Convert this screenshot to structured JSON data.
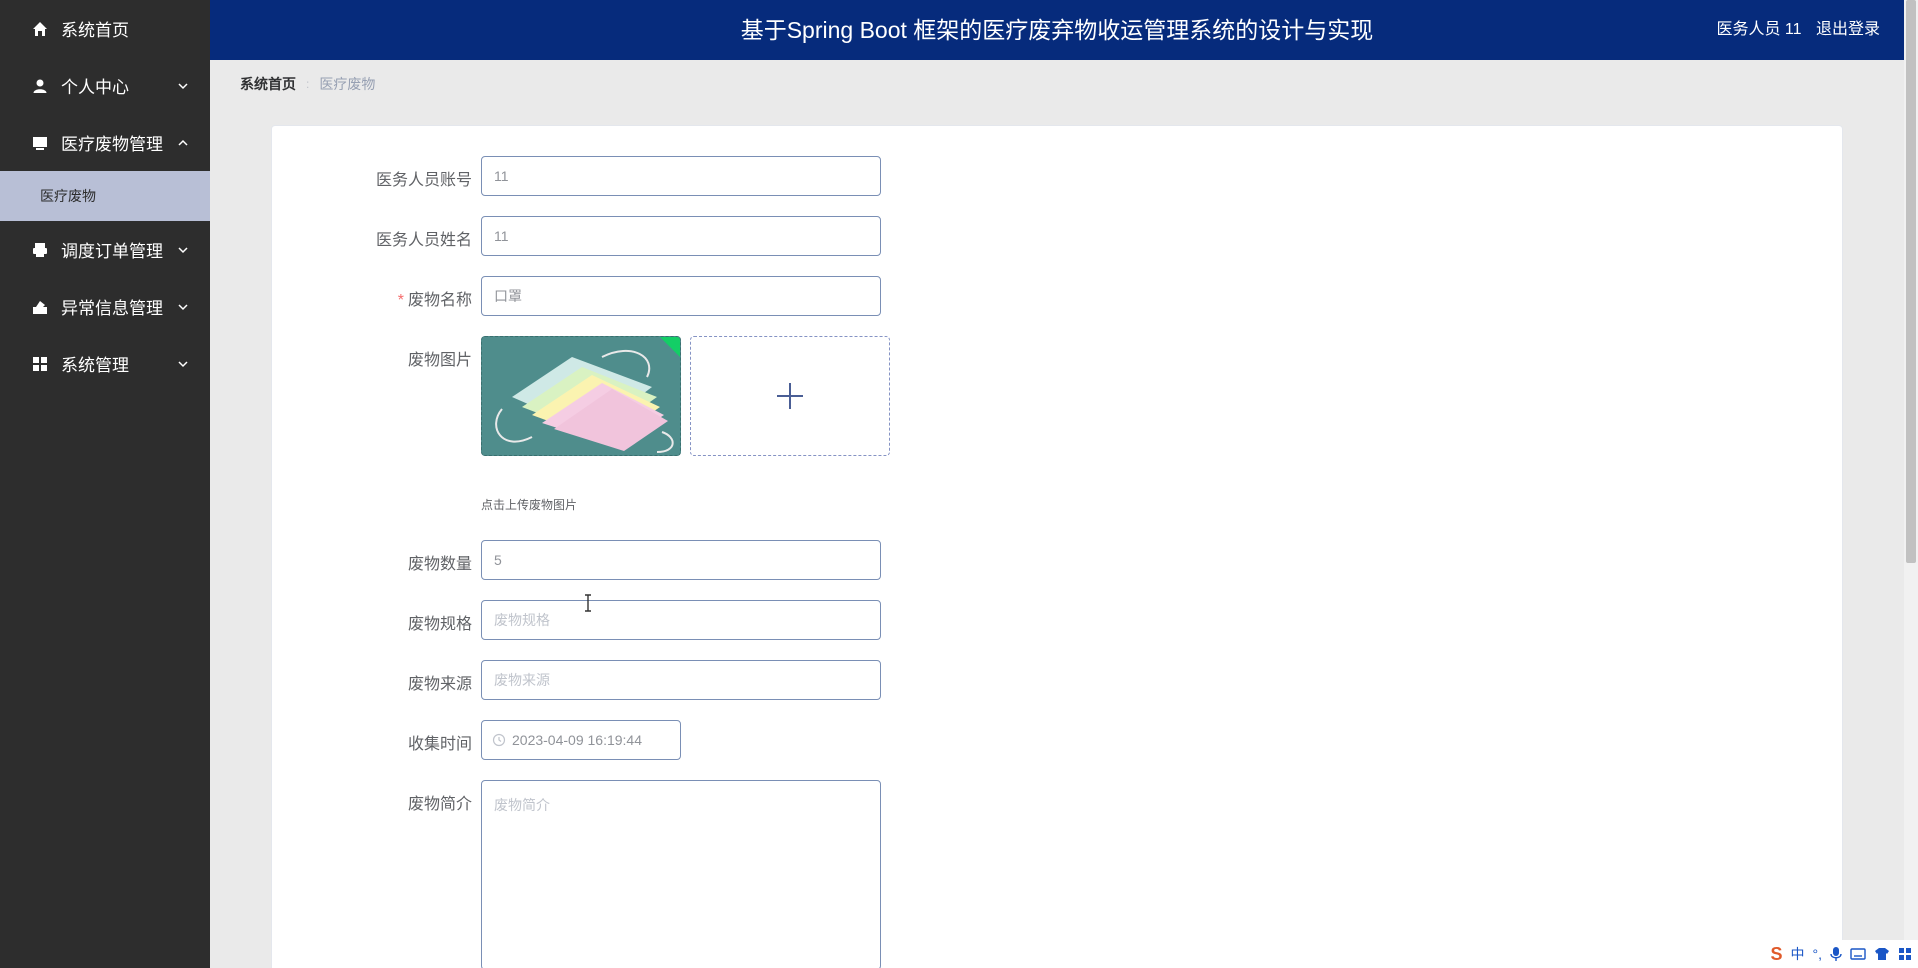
{
  "header": {
    "title": "基于Spring Boot 框架的医疗废弃物收运管理系统的设计与实现",
    "user": "医务人员 11",
    "logout": "退出登录"
  },
  "sidebar": {
    "items": [
      {
        "label": "系统首页",
        "icon": "home-icon"
      },
      {
        "label": "个人中心",
        "icon": "user-icon"
      },
      {
        "label": "医疗废物管理",
        "icon": "monitor-icon"
      },
      {
        "label": "调度订单管理",
        "icon": "printer-icon"
      },
      {
        "label": "异常信息管理",
        "icon": "warning-icon"
      },
      {
        "label": "系统管理",
        "icon": "grid-icon"
      }
    ],
    "submenu": {
      "label": "医疗废物"
    }
  },
  "breadcrumb": {
    "home": "系统首页",
    "separator": ":",
    "current": "医疗废物"
  },
  "form": {
    "account": {
      "label": "医务人员账号",
      "value": "11"
    },
    "name": {
      "label": "医务人员姓名",
      "value": "11"
    },
    "waste_name": {
      "label": "废物名称",
      "value": "口罩",
      "required": "*"
    },
    "image": {
      "label": "废物图片",
      "tip": "点击上传废物图片"
    },
    "quantity": {
      "label": "废物数量",
      "value": "5"
    },
    "spec": {
      "label": "废物规格",
      "placeholder": "废物规格"
    },
    "source": {
      "label": "废物来源",
      "placeholder": "废物来源"
    },
    "collect_time": {
      "label": "收集时间",
      "value": "2023-04-09 16:19:44"
    },
    "intro": {
      "label": "废物简介",
      "placeholder": "废物简介"
    }
  },
  "ime": {
    "lang": "中",
    "punct": "°,"
  },
  "colors": {
    "header_bg": "#062b7c",
    "sidebar_bg": "#2d2d2d",
    "submenu_bg": "#b8bfd6",
    "required": "#f56c6c"
  }
}
